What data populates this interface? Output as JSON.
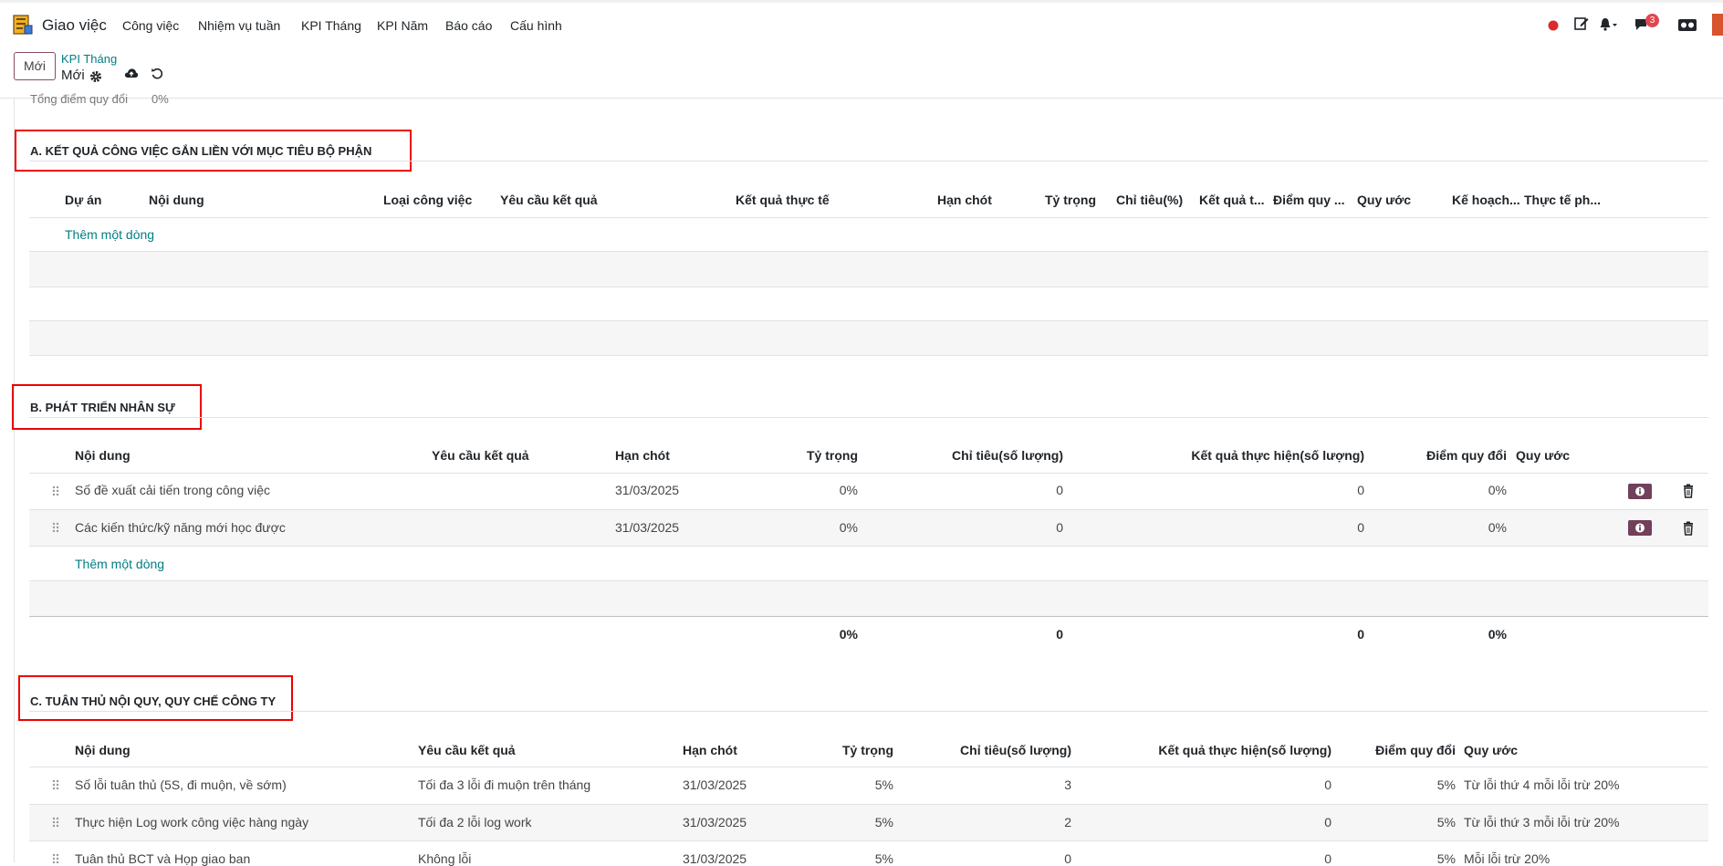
{
  "app": {
    "name": "Giao việc"
  },
  "menu": [
    "Công việc",
    "Nhiệm vụ tuần",
    "KPI Tháng",
    "KPI Năm",
    "Báo cáo",
    "Cấu hình"
  ],
  "systray": {
    "chat_badge": "3"
  },
  "control": {
    "new_button": "Mới",
    "breadcrumb": "KPI Tháng",
    "record": "Mới"
  },
  "summary": {
    "label": "Tổng điểm quy đổi",
    "value": "0%"
  },
  "section_a": {
    "title": "A. KẾT QUẢ CÔNG VIỆC GẮN LIỀN VỚI MỤC TIÊU BỘ PHẬN",
    "headers": [
      "Dự án",
      "Nội dung",
      "Loại công việc",
      "Yêu cầu kết quả",
      "Kết quả thực tế",
      "Hạn chót",
      "Tỷ trọng",
      "Chỉ tiêu(%)",
      "Kết quả t...",
      "Điểm quy ...",
      "Quy ước",
      "Kế hoạch...",
      "Thực tế ph..."
    ],
    "add_line": "Thêm một dòng"
  },
  "section_b": {
    "title": "B. PHÁT TRIỂN NHÂN SỰ",
    "headers": [
      "Nội dung",
      "Yêu cầu kết quả",
      "Hạn chót",
      "Tỷ trọng",
      "Chỉ tiêu(số lượng)",
      "Kết quả thực hiện(số lượng)",
      "Điểm quy đổi",
      "Quy ước"
    ],
    "rows": [
      {
        "content": "Số đề xuất cải tiến trong công việc",
        "requirement": "",
        "deadline": "31/03/2025",
        "weight": "0%",
        "target": "0",
        "result": "0",
        "score": "0%",
        "rule": ""
      },
      {
        "content": "Các kiến thức/kỹ năng mới học được",
        "requirement": "",
        "deadline": "31/03/2025",
        "weight": "0%",
        "target": "0",
        "result": "0",
        "score": "0%",
        "rule": ""
      }
    ],
    "add_line": "Thêm một dòng",
    "totals": {
      "weight": "0%",
      "target": "0",
      "result": "0",
      "score": "0%"
    }
  },
  "section_c": {
    "title": "C. TUÂN THỦ NỘI QUY, QUY CHẾ CÔNG TY",
    "headers": [
      "Nội dung",
      "Yêu cầu kết quả",
      "Hạn chót",
      "Tỷ trọng",
      "Chỉ tiêu(số lượng)",
      "Kết quả thực hiện(số lượng)",
      "Điểm quy đổi",
      "Quy ước"
    ],
    "rows": [
      {
        "content": "Số lỗi tuân thủ (5S, đi muộn, về sớm)",
        "requirement": "Tối đa 3 lỗi đi muộn trên tháng",
        "deadline": "31/03/2025",
        "weight": "5%",
        "target": "3",
        "result": "0",
        "score": "5%",
        "rule": "Từ lỗi thứ 4 mỗi lỗi trừ 20%"
      },
      {
        "content": "Thực hiện Log work công việc hàng ngày",
        "requirement": "Tối đa 2 lỗi log work",
        "deadline": "31/03/2025",
        "weight": "5%",
        "target": "2",
        "result": "0",
        "score": "5%",
        "rule": "Từ lỗi thứ 3 mỗi lỗi trừ 20%"
      },
      {
        "content": "Tuân thủ BCT và Họp giao ban",
        "requirement": "Không lỗi",
        "deadline": "31/03/2025",
        "weight": "5%",
        "target": "0",
        "result": "0",
        "score": "5%",
        "rule": "Mỗi lỗi trừ 20%"
      }
    ]
  },
  "colors": {
    "accent": "#71405b",
    "link": "#017e84",
    "highlight": "#e00000"
  }
}
